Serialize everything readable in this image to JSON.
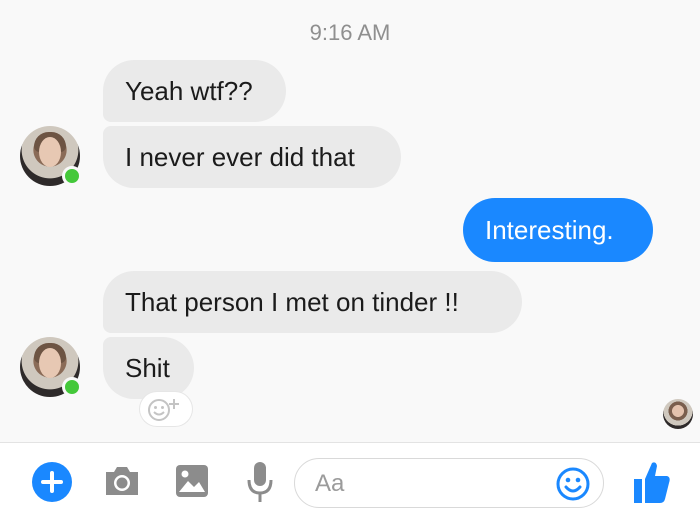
{
  "timestamp": "9:16 AM",
  "messages": [
    {
      "text": "Yeah wtf??",
      "direction": "incoming"
    },
    {
      "text": "I never ever did that",
      "direction": "incoming"
    },
    {
      "text": "Interesting.",
      "direction": "outgoing"
    },
    {
      "text": "That person I met on tinder !!",
      "direction": "incoming"
    },
    {
      "text": "Shit",
      "direction": "incoming"
    }
  ],
  "composer": {
    "placeholder": "Aa",
    "icons": [
      "plus-icon",
      "camera-icon",
      "image-icon",
      "microphone-icon",
      "emoji-icon",
      "thumbs-up-icon"
    ]
  },
  "colors": {
    "accent": "#1a88ff",
    "incoming_bubble": "#eaeaea",
    "online": "#44c83a"
  }
}
